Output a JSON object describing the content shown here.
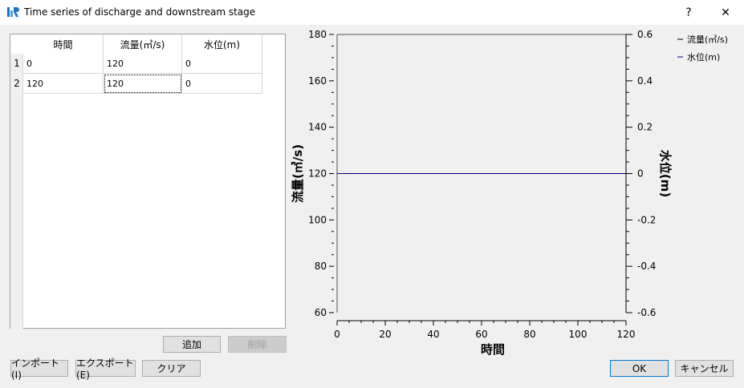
{
  "window": {
    "title": "Time series of discharge and downstream stage",
    "help": "?",
    "close": "✕"
  },
  "table": {
    "headers": [
      "時間",
      "流量(㎥/s)",
      "水位(m)"
    ],
    "row_labels": [
      "1",
      "2"
    ],
    "rows": [
      [
        "0",
        "120",
        "0"
      ],
      [
        "120",
        "120",
        "0"
      ]
    ]
  },
  "buttons": {
    "add": "追加",
    "delete": "削除",
    "import": "インポート(I)",
    "export": "エクスポート(E)",
    "clear": "クリア",
    "ok": "OK",
    "cancel": "キャンセル"
  },
  "chart_data": {
    "type": "line",
    "xlabel": "時間",
    "ylabel": "流量(㎥/s)",
    "y2label": "水位(m)",
    "xlim": [
      0,
      120
    ],
    "ylim": [
      60,
      180
    ],
    "y2lim": [
      -0.6,
      0.6
    ],
    "xticks": [
      "0",
      "20",
      "40",
      "60",
      "80",
      "100",
      "120"
    ],
    "yticks": [
      "60",
      "80",
      "100",
      "120",
      "140",
      "160",
      "180"
    ],
    "y2ticks": [
      "-0.6",
      "-0.4",
      "-0.2",
      "0",
      "0.2",
      "0.4",
      "0.6"
    ],
    "series": [
      {
        "name": "流量(㎥/s)",
        "axis": "left",
        "color": "#000000",
        "x": [
          0,
          120
        ],
        "y": [
          120,
          120
        ]
      },
      {
        "name": "水位(m)",
        "axis": "right",
        "color": "#000080",
        "x": [
          0,
          120
        ],
        "y": [
          0,
          0
        ]
      }
    ],
    "legend": "top-right",
    "grid": false
  }
}
